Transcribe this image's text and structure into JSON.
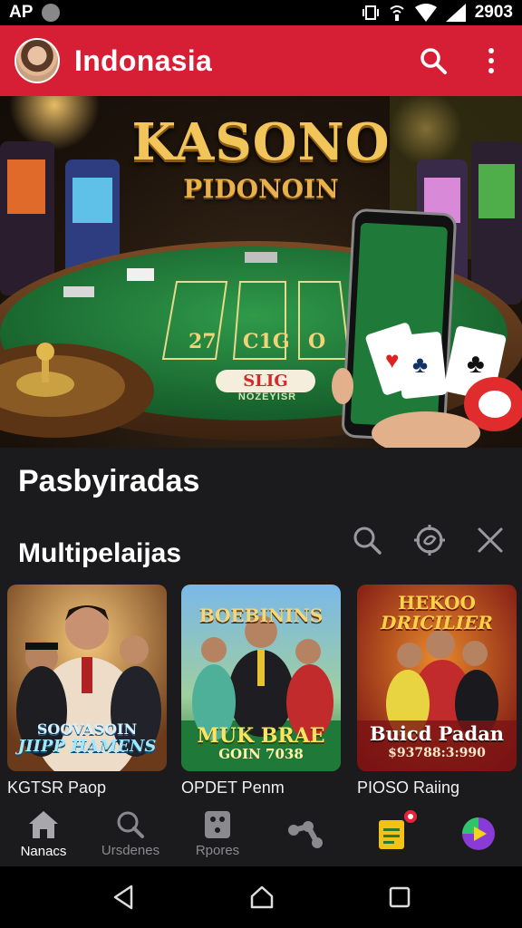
{
  "status_bar": {
    "carrier": "AP",
    "time": "2903"
  },
  "app_bar": {
    "title": "Indonasia"
  },
  "hero": {
    "title": "KASONO",
    "subtitle": "PIDONOIN",
    "table_sign": "SLIG",
    "table_sub": "NOZEYISR",
    "table_numbers": [
      "27",
      "C1G",
      "O"
    ]
  },
  "sections": {
    "featured": "Pasbyiradas",
    "multiplayer": "Multipelaijas"
  },
  "cards": [
    {
      "label": "KGTSR Paop",
      "banner": "SOOVASOIN",
      "banner2": "JIIPP HAMENS"
    },
    {
      "label": "OPDET Penm",
      "banner_top": "BOEBININS",
      "banner": "MUK BRAE",
      "banner2": "GOIN 7038"
    },
    {
      "label": "PIOSO Raiing",
      "banner_top": "HEKOO",
      "banner_top2": "DRICILIER",
      "banner": "Buicd Padan",
      "banner2": "$93788:3:990"
    }
  ],
  "bottom_nav": [
    {
      "label": "Nanacs",
      "icon": "home-icon",
      "active": true
    },
    {
      "label": "Ursdenes",
      "icon": "search-icon",
      "active": false
    },
    {
      "label": "Rpores",
      "icon": "dice-icon",
      "active": false
    },
    {
      "label": "",
      "icon": "share-icon",
      "active": false
    },
    {
      "label": "",
      "icon": "document-icon",
      "active": false
    },
    {
      "label": "",
      "icon": "play-icon",
      "active": false
    }
  ],
  "colors": {
    "brand": "#d61f35",
    "background": "#1b1b1d",
    "gold": "#f2c55b",
    "felt": "#1f7a3a"
  }
}
